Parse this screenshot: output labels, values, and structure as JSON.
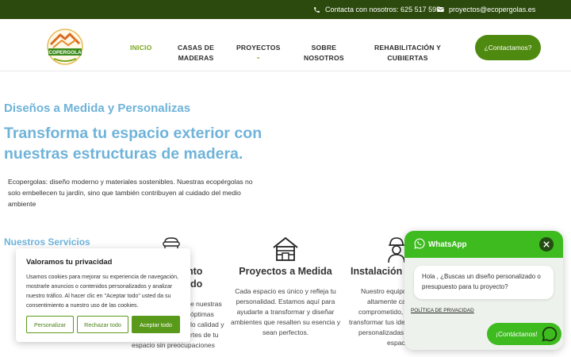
{
  "topbar": {
    "phone_text": "Contacta con nosotros: 625 517 595",
    "email_text": "proyectos@ecopergolas.es"
  },
  "header": {
    "logo_text": "ECOPERGOLAS",
    "nav": [
      {
        "label": "INICIO",
        "active": true
      },
      {
        "label": "CASAS DE\nMADERAS"
      },
      {
        "label": "PROYECTOS",
        "has_dropdown": true
      },
      {
        "label": "SOBRE\nNOSOTROS"
      },
      {
        "label": "REHABILITACIÓN Y\nCUBIERTAS"
      }
    ],
    "cta_label": "¿Contactamos?"
  },
  "hero": {
    "subtitle": "Diseños a Medida y Personalizas",
    "title": "Transforma tu espacio exterior con nuestras estructuras de madera.",
    "description": "Ecopergolas: diseño moderno y materiales sostenibles. Nuestras ecopérgolas no solo embellecen tu jardín, sino que también contribuyen al cuidado del medio ambiente"
  },
  "services": {
    "heading": "Nuestros Servicios",
    "items": [
      {
        "title_partial_1": "nto",
        "title_partial_2": "do",
        "text_lines": [
          "e nuestras",
          "óptimas",
          "lo calidad y",
          "rtes de tu",
          "espacio sin preocupaciones"
        ]
      },
      {
        "title": "Proyectos a Medida",
        "text_lines": [
          "Cada espacio es único y refleja tu",
          "personalidad. Estamos aquí para",
          "ayudarte a transformar y diseñar",
          "ambientes que resalten su esencia y",
          "sean perfectos."
        ]
      },
      {
        "title_partial": "Instalación P",
        "text_lines": [
          "Nuestro equipo",
          "altamente cap",
          "comprometido, e",
          "transformar tus idea",
          "personalizadas c",
          "espacio"
        ]
      }
    ]
  },
  "cookie": {
    "title": "Valoramos tu privacidad",
    "text": "Usamos cookies para mejorar su experiencia de navegación, mostrarle anuncios o contenidos personalizados y analizar nuestro tráfico. Al hacer clic en \"Aceptar todo\" usted da su consentimiento a nuestro uso de las cookies.",
    "btn_customize": "Personalizar",
    "btn_reject": "Rechazar todo",
    "btn_accept": "Aceptar todo"
  },
  "whatsapp": {
    "brand": "WhatsApp",
    "message": "Hola , ¿Buscas un diseño personalizado o presupuesto para tu proyecto?",
    "privacy": "POLÍTICA DE PRIVACIDAD",
    "button_label": "¡Contáctanos!"
  },
  "colors": {
    "topbar_bg": "#2d4a0e",
    "accent_green": "#7ba61e",
    "cta_green": "#4f8a10",
    "heading_blue": "#6fb3da",
    "whatsapp_green": "#3dbb1f"
  }
}
